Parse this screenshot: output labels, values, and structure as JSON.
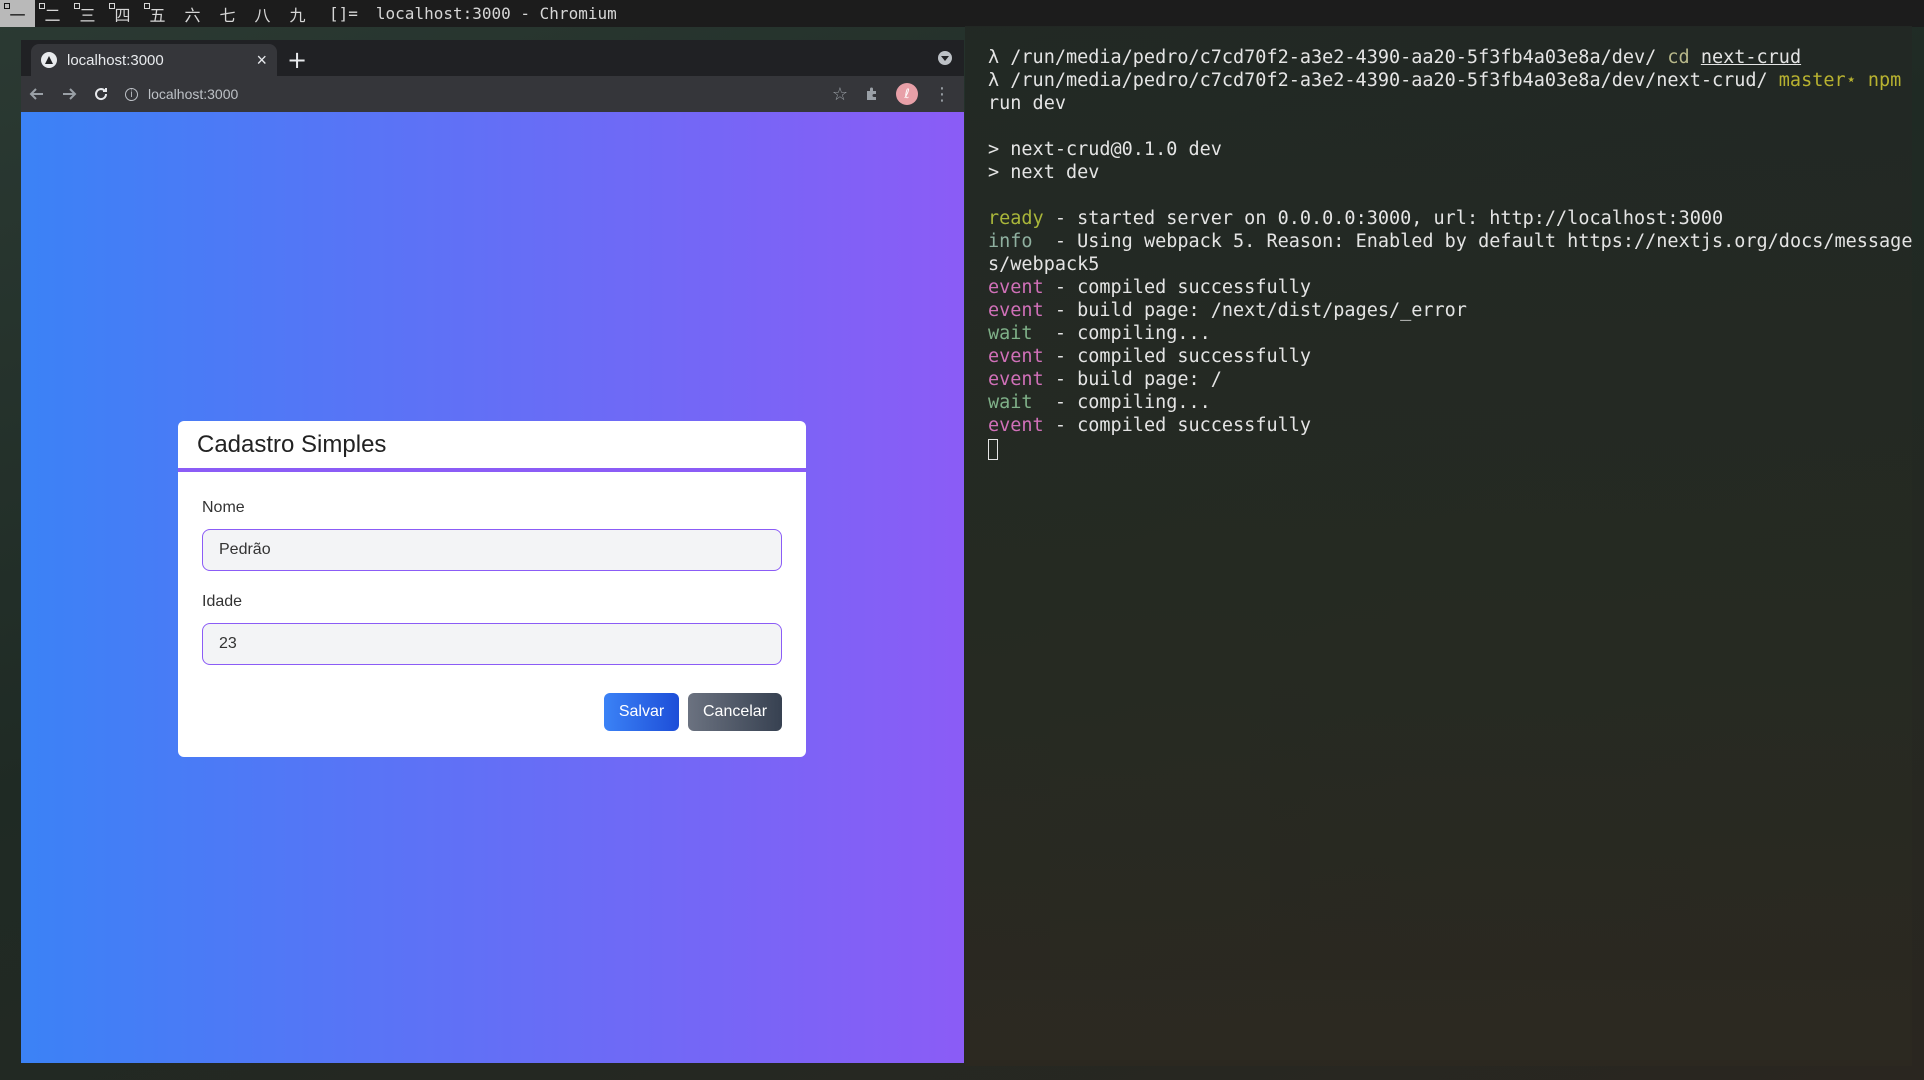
{
  "wm": {
    "workspaces": [
      "一",
      "二",
      "三",
      "四",
      "五",
      "六",
      "七",
      "八",
      "九"
    ],
    "layout": "[]=",
    "window_title": "localhost:3000 - Chromium"
  },
  "browser": {
    "tab_title": "localhost:3000",
    "tab_close": "×",
    "new_tab": "+",
    "url": "localhost:3000",
    "avatar_letter": "ℓ"
  },
  "form": {
    "title": "Cadastro Simples",
    "nome_label": "Nome",
    "nome_value": "Pedrão",
    "idade_label": "Idade",
    "idade_value": "23",
    "save_label": "Salvar",
    "cancel_label": "Cancelar",
    "colors": {
      "accent": "#8b5cf6",
      "gradient_start": "#3b82f6",
      "gradient_end": "#8b5cf6"
    }
  },
  "terminal": {
    "line1_prompt": "λ /run/media/pedro/c7cd70f2-a3e2-4390-aa20-5f3fb4a03e8a/dev/ ",
    "line1_cmd": "cd",
    "line1_arg": "next-crud",
    "line2_prompt": "λ /run/media/pedro/c7cd70f2-a3e2-4390-aa20-5f3fb4a03e8a/dev/next-crud/ ",
    "line2_git": "master⋆",
    "line2_cmd": "npm",
    "line3": "run dev",
    "line5": "> next-crud@0.1.0 dev",
    "line6": "> next dev",
    "log": [
      {
        "key": "ready",
        "cls": "k-ready",
        "text": " - started server on 0.0.0.0:3000, url: http://localhost:3000"
      },
      {
        "key": "info",
        "cls": "k-info",
        "text": "  - Using webpack 5. Reason: Enabled by default https://nextjs.org/docs/message"
      },
      {
        "key": "",
        "cls": "",
        "text": "s/webpack5"
      },
      {
        "key": "event",
        "cls": "k-event",
        "text": " - compiled successfully"
      },
      {
        "key": "event",
        "cls": "k-event",
        "text": " - build page: /next/dist/pages/_error"
      },
      {
        "key": "wait",
        "cls": "k-wait",
        "text": "  - compiling..."
      },
      {
        "key": "event",
        "cls": "k-event",
        "text": " - compiled successfully"
      },
      {
        "key": "event",
        "cls": "k-event",
        "text": " - build page: /"
      },
      {
        "key": "wait",
        "cls": "k-wait",
        "text": "  - compiling..."
      },
      {
        "key": "event",
        "cls": "k-event",
        "text": " - compiled successfully"
      }
    ]
  }
}
